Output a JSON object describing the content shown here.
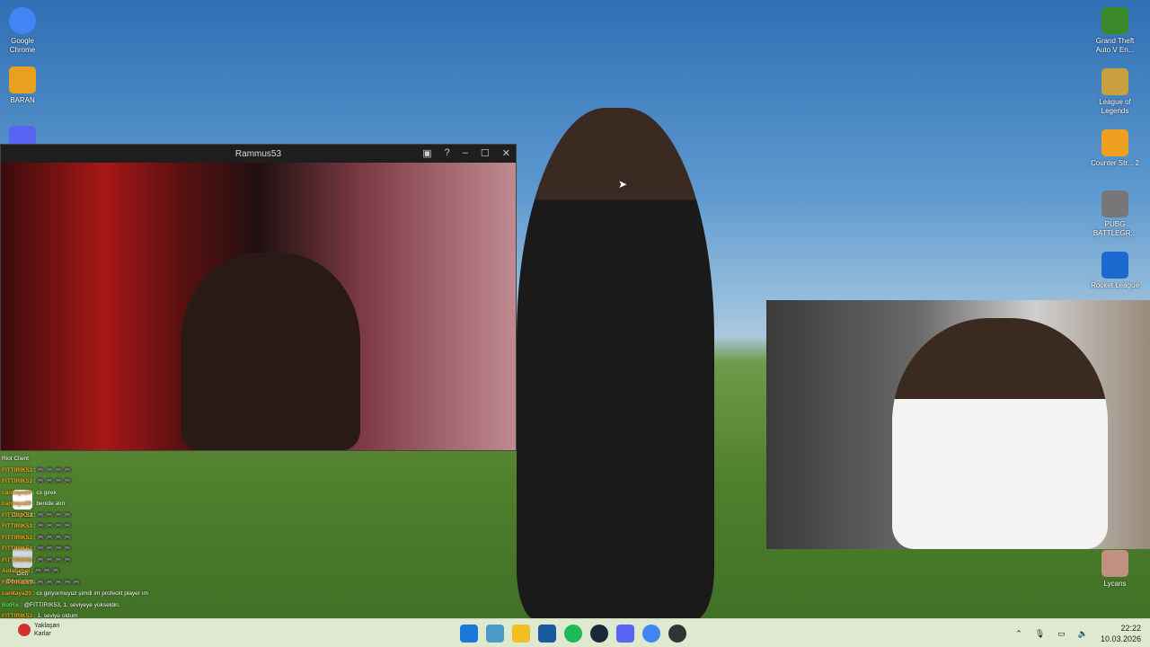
{
  "desktop_left": [
    {
      "label": "Google Chrome",
      "icon": "chrome-icon",
      "color": "#4285f4"
    },
    {
      "label": "BARAN",
      "icon": "app-icon",
      "color": "#e8a020"
    },
    {
      "label": "",
      "icon": "discord-icon",
      "color": "#5865f2"
    }
  ],
  "desktop_right": [
    {
      "label": "Grand Theft Auto V En...",
      "icon": "gta-icon",
      "color": "#3a8a2a"
    },
    {
      "label": "League of Legends",
      "icon": "lol-icon",
      "color": "#c8a040"
    },
    {
      "label": "Counter Str... 2",
      "icon": "cs2-icon",
      "color": "#f0a020"
    },
    {
      "label": "PUBG BATTLEGR...",
      "icon": "pubg-icon",
      "color": "#777"
    },
    {
      "label": "Rocket League",
      "icon": "rocket-league-icon",
      "color": "#1a6ad0"
    },
    {
      "label": "Lycans",
      "icon": "lycans-icon",
      "color": "#c09080"
    }
  ],
  "window": {
    "title": "Rammus53",
    "controls": [
      "pip",
      "help",
      "minimize",
      "maximize",
      "close"
    ]
  },
  "chat": {
    "header": "Riot Client",
    "messages": [
      {
        "user": "FITTIRIK53",
        "text": ": 🎮 🎮 🎮 🎮"
      },
      {
        "user": "FITTIRIK53",
        "text": ": 🎮 🎮 🎮 🎮"
      },
      {
        "user": "cankaya20",
        "text": ": cs girek"
      },
      {
        "user": "cankaya20",
        "text": ": benide alın"
      },
      {
        "user": "FITTIRIK53",
        "text": ": 🎮 🎮 🎮 🎮"
      },
      {
        "user": "FITTIRIK53",
        "text": ": 🎮 🎮 🎮 🎮"
      },
      {
        "user": "FITTIRIK53",
        "text": ": 🎮 🎮 🎮 🎮"
      },
      {
        "user": "FITTIRIK53",
        "text": ": 🎮 🎮 🎮 🎮"
      },
      {
        "user": "FITTIRIK53",
        "text": ": 🎮 🎮 🎮 🎮"
      },
      {
        "user": "AidaEzhel",
        "text": ": 🎮 🎮 🎮"
      },
      {
        "user": "FITTIRIK53",
        "text": ": 🎮 🎮 🎮 🎮 🎮"
      },
      {
        "user": "cankaya20",
        "text": ": cs giriyormuyuz şimdi ım profeckt player ım"
      },
      {
        "user": "BotRix",
        "text": ": @FITTIRIK53, 1. seviyeye yükseldin.",
        "bot": true
      },
      {
        "user": "FITTIRIK53",
        "text": ": 1. seviye oldum"
      }
    ]
  },
  "desktop_overlay_labels": [
    "CapCut",
    "Geri Dönüşüm...",
    "Yaklaşan Karlar"
  ],
  "taskbar": {
    "icons": [
      "windows-start-icon",
      "copilot-icon",
      "file-explorer-icon",
      "store-icon",
      "spotify-icon",
      "steam-icon",
      "discord-icon",
      "chrome-icon",
      "obs-icon"
    ],
    "colors": [
      "#1a78d8",
      "#4a9ac8",
      "#f0c020",
      "#1a5aa0",
      "#1db954",
      "#1b2838",
      "#5865f2",
      "#4285f4",
      "#333"
    ],
    "time": "22:22",
    "date": "10.03.2026"
  }
}
